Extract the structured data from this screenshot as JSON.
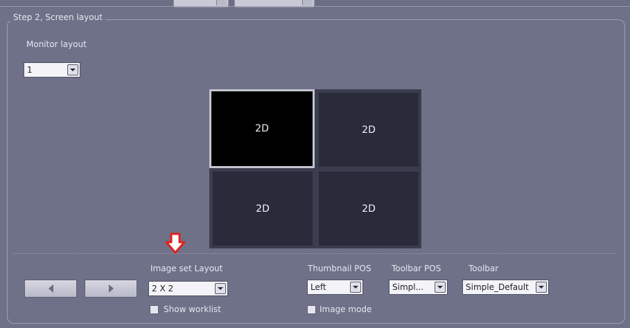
{
  "panel": {
    "title": "Step 2, Screen layout"
  },
  "monitor_layout": {
    "label": "Monitor layout",
    "value": "1"
  },
  "cells": [
    "2D",
    "2D",
    "2D",
    "2D"
  ],
  "image_set_layout": {
    "label": "Image set Layout",
    "value": "2 X 2"
  },
  "show_worklist": {
    "label": "Show worklist",
    "checked": false
  },
  "thumbnail_pos": {
    "label": "Thumbnail POS",
    "value": "Left"
  },
  "image_mode": {
    "label": "Image mode",
    "checked": false
  },
  "toolbar_pos": {
    "label": "Toolbar POS",
    "value": "Simpl..."
  },
  "toolbar": {
    "label": "Toolbar",
    "value": "Simple_Default"
  },
  "colors": {
    "accent_arrow": "#e0211d",
    "panel_bg": "#6f7189",
    "selected_border": "#c4c5cf"
  }
}
